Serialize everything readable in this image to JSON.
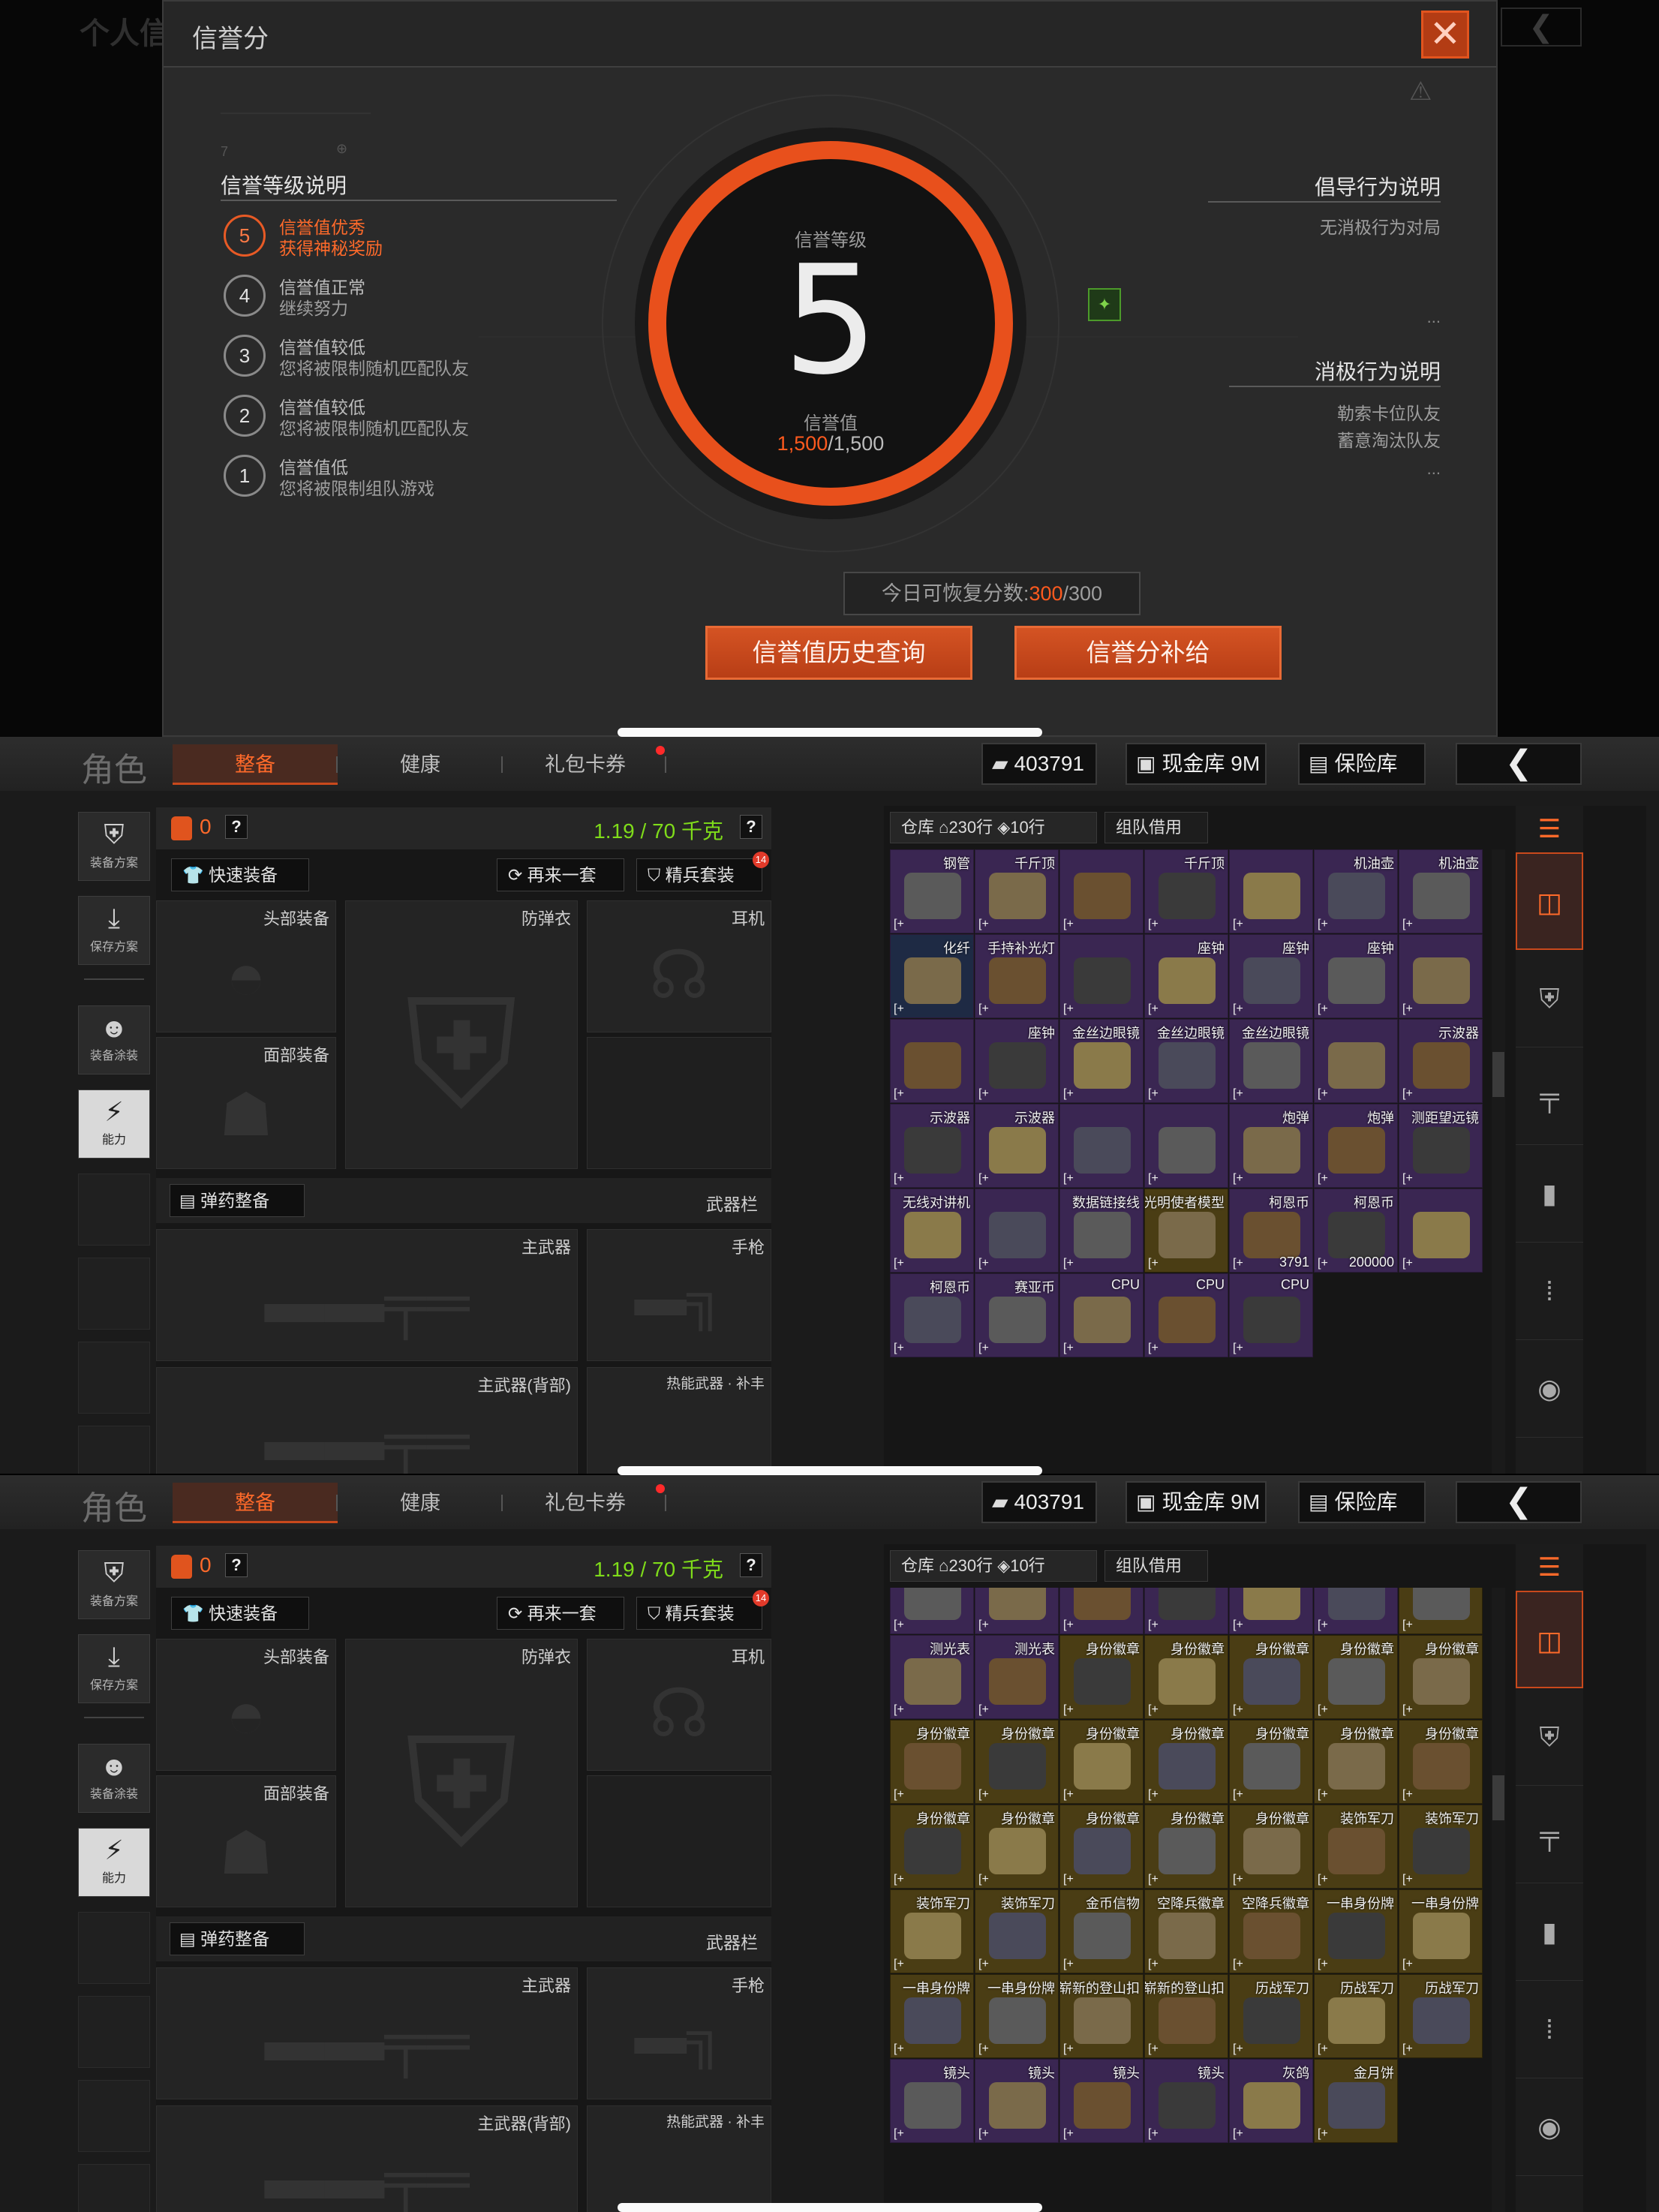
{
  "credit": {
    "bg_title": "个人信",
    "modal_title": "信誉分",
    "close_symbol": "✕",
    "levels_heading": "信誉等级说明",
    "levels": [
      {
        "num": "5",
        "line1": "信誉值优秀",
        "line2": "获得神秘奖励",
        "active": true
      },
      {
        "num": "4",
        "line1": "信誉值正常",
        "line2": "继续努力",
        "active": false
      },
      {
        "num": "3",
        "line1": "信誉值较低",
        "line2": "您将被限制随机匹配队友",
        "active": false
      },
      {
        "num": "2",
        "line1": "信誉值较低",
        "line2": "您将被限制随机匹配队友",
        "active": false
      },
      {
        "num": "1",
        "line1": "信誉值低",
        "line2": "您将被限制组队游戏",
        "active": false
      }
    ],
    "gauge": {
      "level_label": "信誉等级",
      "level_value": "5",
      "score_label": "信誉值",
      "score_current": "1,500",
      "score_max": "/1,500"
    },
    "advocated": {
      "heading": "倡导行为说明",
      "item": "无消极行为对局",
      "dots": "..."
    },
    "negative": {
      "heading": "消极行为说明",
      "items": [
        "勒索卡位队友",
        "蓄意淘汰队友"
      ],
      "dots": "..."
    },
    "recover": {
      "label": "今日可恢复分数:",
      "current": "300",
      "max": "/300"
    },
    "buttons": {
      "history": "信誉值历史查询",
      "compensate": "信誉分补给"
    }
  },
  "equip": {
    "nav": {
      "title": "角色",
      "tabs": [
        "整备",
        "健康",
        "礼包卡券"
      ],
      "money": "403791",
      "cash_vault": "现金库 9M",
      "safe_vault": "保险库",
      "back_symbol": "❮"
    },
    "side": {
      "loadout_plan": "装备方案",
      "save_plan": "保存方案",
      "paint": "装备涂装",
      "ability": "能力"
    },
    "char": {
      "bag_count": "0",
      "weight": "1.19 / 70 千克",
      "qmark": "?",
      "quick_equip": "快速装备",
      "again_set": "再来一套",
      "elite_set": "精兵套装",
      "elite_badge": "14",
      "slots": {
        "head": "头部装备",
        "armor": "防弹衣",
        "ear": "耳机",
        "face": "面部装备",
        "main_weapon": "主武器",
        "pistol": "手枪",
        "main_back": "主武器(背部)",
        "thermal": "热能武器 · 补丰"
      },
      "ammo_btn": "弹药整备",
      "weapon_bar": "武器栏"
    },
    "stash": {
      "tab_warehouse": "仓库",
      "rows": "230行",
      "rows2": "10行",
      "team_borrow": "组队借用"
    },
    "colors": {
      "accent": "#e8501c",
      "purple": "#3a2652",
      "gold": "#4a3d14",
      "weight_green": "#7fdc1a"
    }
  },
  "grid1": [
    {
      "name": "钢管",
      "rarity": "purple",
      "qty": ""
    },
    {
      "name": "千斤顶",
      "rarity": "purple",
      "qty": ""
    },
    {
      "name": "",
      "rarity": "purple",
      "qty": ""
    },
    {
      "name": "千斤顶",
      "rarity": "purple",
      "qty": ""
    },
    {
      "name": "",
      "rarity": "purple",
      "qty": ""
    },
    {
      "name": "机油壶",
      "rarity": "purple",
      "qty": ""
    },
    {
      "name": "机油壶",
      "rarity": "purple",
      "qty": ""
    },
    {
      "name": "化纤",
      "rarity": "blue",
      "qty": ""
    },
    {
      "name": "手持补光灯",
      "rarity": "purple",
      "qty": ""
    },
    {
      "name": "",
      "rarity": "purple",
      "qty": ""
    },
    {
      "name": "座钟",
      "rarity": "purple",
      "qty": ""
    },
    {
      "name": "座钟",
      "rarity": "purple",
      "qty": ""
    },
    {
      "name": "座钟",
      "rarity": "purple",
      "qty": ""
    },
    {
      "name": "",
      "rarity": "purple",
      "qty": ""
    },
    {
      "name": "",
      "rarity": "purple",
      "qty": ""
    },
    {
      "name": "座钟",
      "rarity": "purple",
      "qty": ""
    },
    {
      "name": "金丝边眼镜",
      "rarity": "purple",
      "qty": ""
    },
    {
      "name": "金丝边眼镜",
      "rarity": "purple",
      "qty": ""
    },
    {
      "name": "金丝边眼镜",
      "rarity": "purple",
      "qty": ""
    },
    {
      "name": "",
      "rarity": "purple",
      "qty": ""
    },
    {
      "name": "示波器",
      "rarity": "purple",
      "qty": ""
    },
    {
      "name": "示波器",
      "rarity": "purple",
      "qty": ""
    },
    {
      "name": "示波器",
      "rarity": "purple",
      "qty": ""
    },
    {
      "name": "",
      "rarity": "purple",
      "qty": ""
    },
    {
      "name": "",
      "rarity": "purple",
      "qty": ""
    },
    {
      "name": "炮弹",
      "rarity": "purple",
      "qty": ""
    },
    {
      "name": "炮弹",
      "rarity": "purple",
      "qty": ""
    },
    {
      "name": "测距望远镜",
      "rarity": "purple",
      "qty": ""
    },
    {
      "name": "无线对讲机",
      "rarity": "purple",
      "qty": ""
    },
    {
      "name": "",
      "rarity": "purple",
      "qty": ""
    },
    {
      "name": "数据链接线",
      "rarity": "purple",
      "qty": ""
    },
    {
      "name": "光明使者模型",
      "rarity": "gold",
      "qty": ""
    },
    {
      "name": "柯恩币",
      "rarity": "purple",
      "qty": "3791"
    },
    {
      "name": "柯恩币",
      "rarity": "purple",
      "qty": "200000"
    },
    {
      "name": "",
      "rarity": "purple",
      "qty": ""
    },
    {
      "name": "柯恩币",
      "rarity": "purple",
      "qty": ""
    },
    {
      "name": "赛亚币",
      "rarity": "purple",
      "qty": ""
    },
    {
      "name": "CPU",
      "rarity": "purple",
      "qty": ""
    },
    {
      "name": "CPU",
      "rarity": "purple",
      "qty": ""
    },
    {
      "name": "CPU",
      "rarity": "purple",
      "qty": ""
    }
  ],
  "grid2": [
    {
      "name": "",
      "rarity": "purple"
    },
    {
      "name": "",
      "rarity": "purple"
    },
    {
      "name": "",
      "rarity": "purple"
    },
    {
      "name": "",
      "rarity": "purple"
    },
    {
      "name": "",
      "rarity": "purple"
    },
    {
      "name": "",
      "rarity": "purple"
    },
    {
      "name": "",
      "rarity": "gold"
    },
    {
      "name": "测光表",
      "rarity": "purple"
    },
    {
      "name": "测光表",
      "rarity": "purple"
    },
    {
      "name": "身份徽章",
      "rarity": "gold"
    },
    {
      "name": "身份徽章",
      "rarity": "gold"
    },
    {
      "name": "身份徽章",
      "rarity": "gold"
    },
    {
      "name": "身份徽章",
      "rarity": "gold"
    },
    {
      "name": "身份徽章",
      "rarity": "gold"
    },
    {
      "name": "身份徽章",
      "rarity": "gold"
    },
    {
      "name": "身份徽章",
      "rarity": "gold"
    },
    {
      "name": "身份徽章",
      "rarity": "gold"
    },
    {
      "name": "身份徽章",
      "rarity": "gold"
    },
    {
      "name": "身份徽章",
      "rarity": "gold"
    },
    {
      "name": "身份徽章",
      "rarity": "gold"
    },
    {
      "name": "身份徽章",
      "rarity": "gold"
    },
    {
      "name": "身份徽章",
      "rarity": "gold"
    },
    {
      "name": "身份徽章",
      "rarity": "gold"
    },
    {
      "name": "身份徽章",
      "rarity": "gold"
    },
    {
      "name": "身份徽章",
      "rarity": "gold"
    },
    {
      "name": "身份徽章",
      "rarity": "gold"
    },
    {
      "name": "装饰军刀",
      "rarity": "gold"
    },
    {
      "name": "装饰军刀",
      "rarity": "gold"
    },
    {
      "name": "装饰军刀",
      "rarity": "gold"
    },
    {
      "name": "装饰军刀",
      "rarity": "gold"
    },
    {
      "name": "金币信物",
      "rarity": "gold"
    },
    {
      "name": "空降兵徽章",
      "rarity": "gold"
    },
    {
      "name": "空降兵徽章",
      "rarity": "gold"
    },
    {
      "name": "一串身份牌",
      "rarity": "gold"
    },
    {
      "name": "一串身份牌",
      "rarity": "gold"
    },
    {
      "name": "一串身份牌",
      "rarity": "gold"
    },
    {
      "name": "一串身份牌",
      "rarity": "gold"
    },
    {
      "name": "崭新的登山扣",
      "rarity": "gold"
    },
    {
      "name": "崭新的登山扣",
      "rarity": "gold"
    },
    {
      "name": "历战军刀",
      "rarity": "gold"
    },
    {
      "name": "历战军刀",
      "rarity": "gold"
    },
    {
      "name": "历战军刀",
      "rarity": "gold"
    },
    {
      "name": "镜头",
      "rarity": "purple"
    },
    {
      "name": "镜头",
      "rarity": "purple"
    },
    {
      "name": "镜头",
      "rarity": "purple"
    },
    {
      "name": "镜头",
      "rarity": "purple"
    },
    {
      "name": "灰鸽",
      "rarity": "purple"
    },
    {
      "name": "金月饼",
      "rarity": "gold"
    }
  ]
}
